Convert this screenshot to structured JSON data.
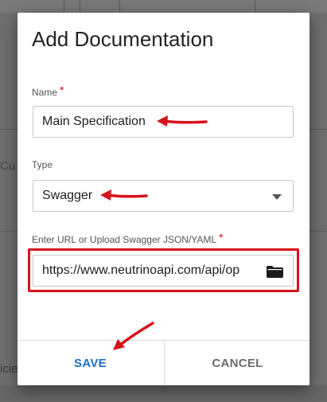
{
  "dialog": {
    "title": "Add Documentation",
    "name_field": {
      "label": "Name",
      "required_mark": "*",
      "value": "Main Specification"
    },
    "type_field": {
      "label": "Type",
      "selected": "Swagger",
      "caret_icon": "caret-down-icon"
    },
    "url_field": {
      "label": "Enter URL or Upload Swagger JSON/YAML",
      "required_mark": "*",
      "value": "https://www.neutrinoapi.com/api/op",
      "browse_icon": "folder-icon"
    },
    "buttons": {
      "save": "SAVE",
      "cancel": "CANCEL"
    }
  },
  "background": {
    "fragment_left_1": "Cu",
    "fragment_left_2": "icie"
  },
  "colors": {
    "annotation": "#d8121b",
    "primary_button": "#1f6fc4",
    "secondary_button": "#6b6b6b",
    "required": "#d0021b"
  }
}
